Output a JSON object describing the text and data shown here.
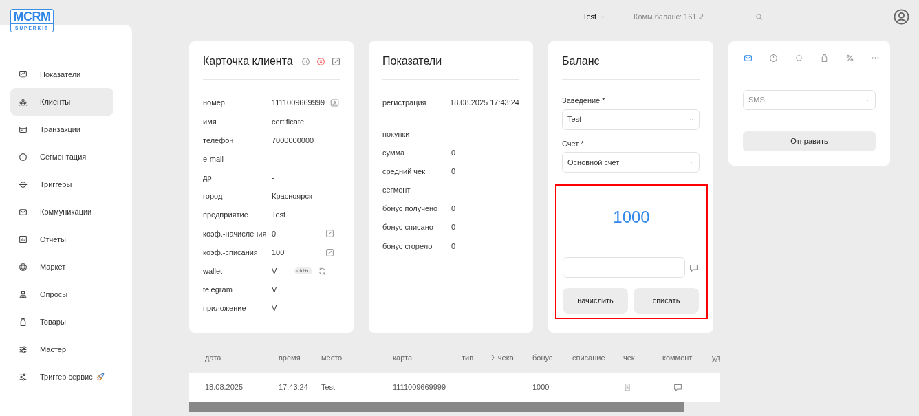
{
  "logo": {
    "title": "MCRM",
    "subtitle": "SUPERKIT"
  },
  "topbar": {
    "venue": "Test",
    "balance": "Комм.баланс: 161 ₽"
  },
  "sidebar": {
    "items": [
      {
        "label": "Показатели",
        "selected": false
      },
      {
        "label": "Клиенты",
        "selected": true
      },
      {
        "label": "Транзакции",
        "selected": false
      },
      {
        "label": "Сегментация",
        "selected": false
      },
      {
        "label": "Триггеры",
        "selected": false
      },
      {
        "label": "Коммуникации",
        "selected": false
      },
      {
        "label": "Отчеты",
        "selected": false
      },
      {
        "label": "Маркет",
        "selected": false
      },
      {
        "label": "Опросы",
        "selected": false
      },
      {
        "label": "Товары",
        "selected": false
      },
      {
        "label": "Мастер",
        "selected": false
      },
      {
        "label": "Триггер сервис",
        "selected": false
      }
    ]
  },
  "client_card": {
    "title": "Карточка клиента",
    "rows": [
      {
        "label": "номер",
        "value": "1111009669999",
        "kind": "card"
      },
      {
        "label": "имя",
        "value": "certificate"
      },
      {
        "label": "телефон",
        "value": "7000000000"
      },
      {
        "label": "e-mail"
      },
      {
        "label": "др",
        "value": "-"
      },
      {
        "label": "город",
        "value": "Красноярск"
      },
      {
        "label": "предприятие",
        "value": "Test"
      },
      {
        "label": "коэф.-начисления",
        "value": "0",
        "kind": "editable"
      },
      {
        "label": "коэф.-списания",
        "value": "100",
        "kind": "editable"
      },
      {
        "label": "wallet",
        "value": "V",
        "badge": "ctrl+c",
        "kind": "wallet"
      },
      {
        "label": "telegram",
        "value": "V"
      },
      {
        "label": "приложение",
        "value": "V"
      }
    ]
  },
  "stats_card": {
    "title": "Показатели",
    "registration": {
      "label": "регистрация",
      "value": "18.08.2025 17:43:24"
    },
    "rows": [
      {
        "label": "покупки"
      },
      {
        "label": "сумма",
        "value": "0"
      },
      {
        "label": "средний чек",
        "value": "0"
      },
      {
        "label": "сегмент"
      },
      {
        "label": "бонус получено",
        "value": "0"
      },
      {
        "label": "бонус списано",
        "value": "0"
      },
      {
        "label": "бонус сгорело",
        "value": "0"
      }
    ]
  },
  "balance_card": {
    "title": "Баланс",
    "venue_label": "Заведение *",
    "venue": "Test",
    "account_label": "Счет *",
    "account": "Основной счет",
    "amount": "1000",
    "buttons": [
      "начислить",
      "списать"
    ]
  },
  "message_card": {
    "tabs": [
      {
        "selected": true
      },
      {
        "selected": false
      },
      {
        "selected": false
      },
      {
        "selected": false
      },
      {
        "selected": false
      },
      {
        "selected": false
      }
    ],
    "channel": "SMS",
    "button": "Отправить"
  },
  "table": {
    "columns": [
      "дата",
      "время",
      "место",
      "карта",
      "тип",
      "Σ чека",
      "бонус",
      "списание",
      "чек",
      "коммент",
      "уд"
    ],
    "rows": [
      [
        {
          "kind": "text",
          "text": "18.08.2025"
        },
        {
          "kind": "text",
          "text": "17:43:24"
        },
        {
          "kind": "text",
          "text": "Test"
        },
        {
          "kind": "text",
          "text": "1111009669999"
        },
        {
          "kind": "blank"
        },
        {
          "kind": "text",
          "text": "-"
        },
        {
          "kind": "text",
          "text": "1000"
        },
        {
          "kind": "text",
          "text": "-"
        },
        {
          "kind": "receipt"
        },
        {
          "kind": "comment"
        }
      ]
    ]
  }
}
